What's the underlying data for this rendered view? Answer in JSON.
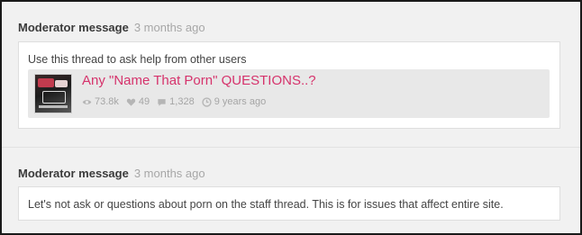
{
  "posts": [
    {
      "author": "Moderator message",
      "time": "3 months ago",
      "body": "Use this thread to ask help from other users",
      "embed": {
        "title": "Any \"Name That Porn\" QUESTIONS..?",
        "views": "73.8k",
        "likes": "49",
        "comments": "1,328",
        "age": "9 years ago",
        "thumbnail_icon": "thread-thumbnail"
      }
    },
    {
      "author": "Moderator message",
      "time": "3 months ago",
      "body": "Let's not ask or questions about porn on the staff thread. This is for issues that affect entire site."
    }
  ],
  "icons": {
    "views": "eye-icon",
    "likes": "heart-icon",
    "comments": "comment-icon",
    "age": "clock-icon"
  },
  "colors": {
    "link": "#d6336c",
    "muted": "#a7a7a7"
  }
}
